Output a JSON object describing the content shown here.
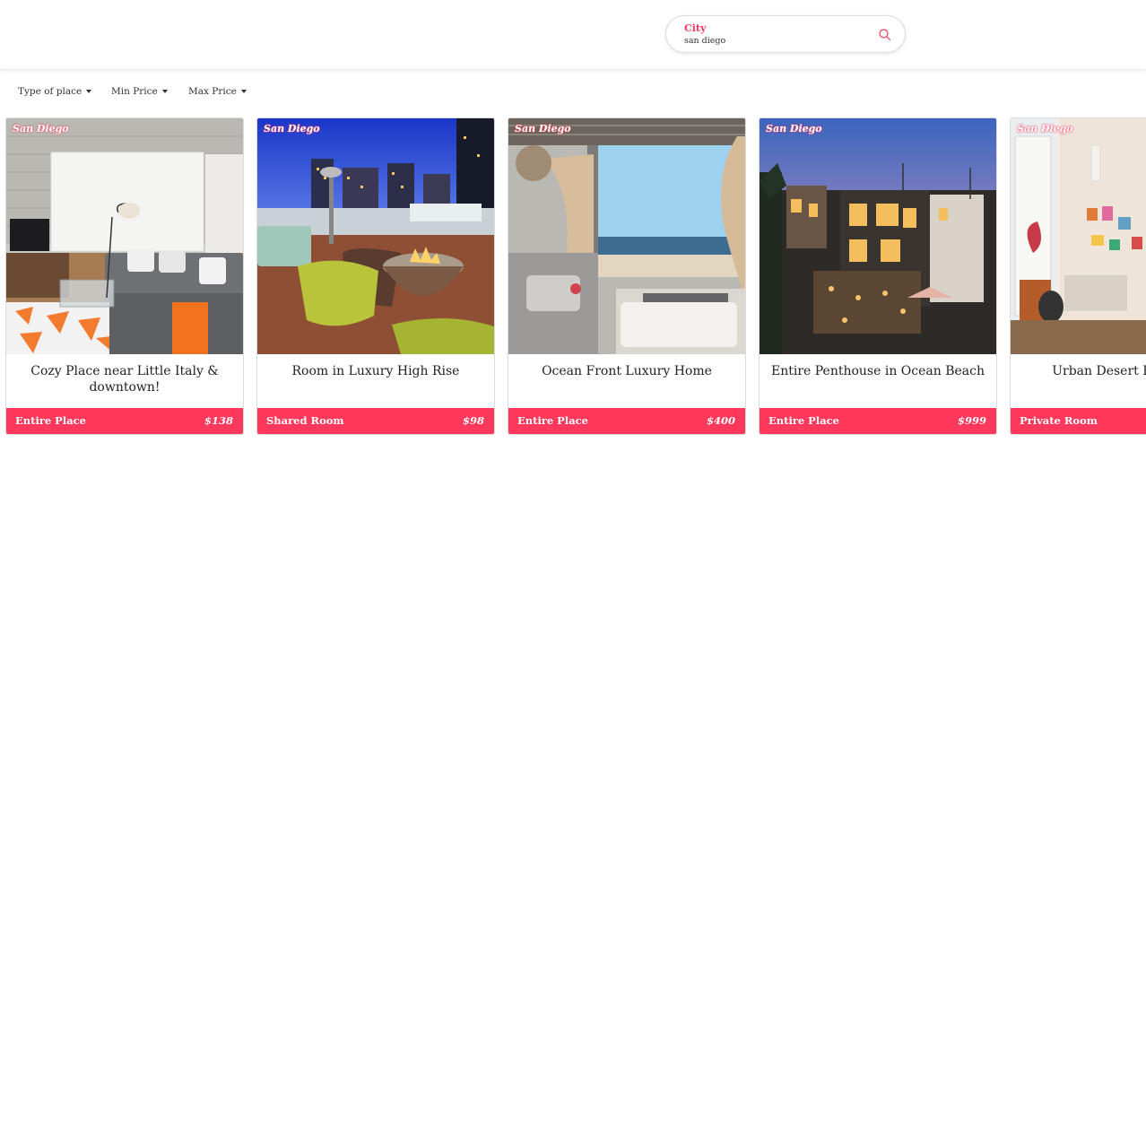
{
  "search": {
    "label": "City",
    "value": "san diego"
  },
  "filters": [
    {
      "label": "Type of place"
    },
    {
      "label": "Min Price"
    },
    {
      "label": "Max Price"
    }
  ],
  "listings": [
    {
      "city": "San Diego",
      "title": "Cozy Place near Little Italy & downtown!",
      "type": "Entire Place",
      "price": "$138"
    },
    {
      "city": "San Diego",
      "title": "Room in Luxury High Rise",
      "type": "Shared Room",
      "price": "$98"
    },
    {
      "city": "San Diego",
      "title": "Ocean Front Luxury Home",
      "type": "Entire Place",
      "price": "$400"
    },
    {
      "city": "San Diego",
      "title": "Entire Penthouse in Ocean Beach",
      "type": "Entire Place",
      "price": "$999"
    },
    {
      "city": "San Diego",
      "title": "Urban Desert Hideaway",
      "type": "Private Room",
      "price": ""
    }
  ],
  "colors": {
    "brand": "#ff385c"
  }
}
